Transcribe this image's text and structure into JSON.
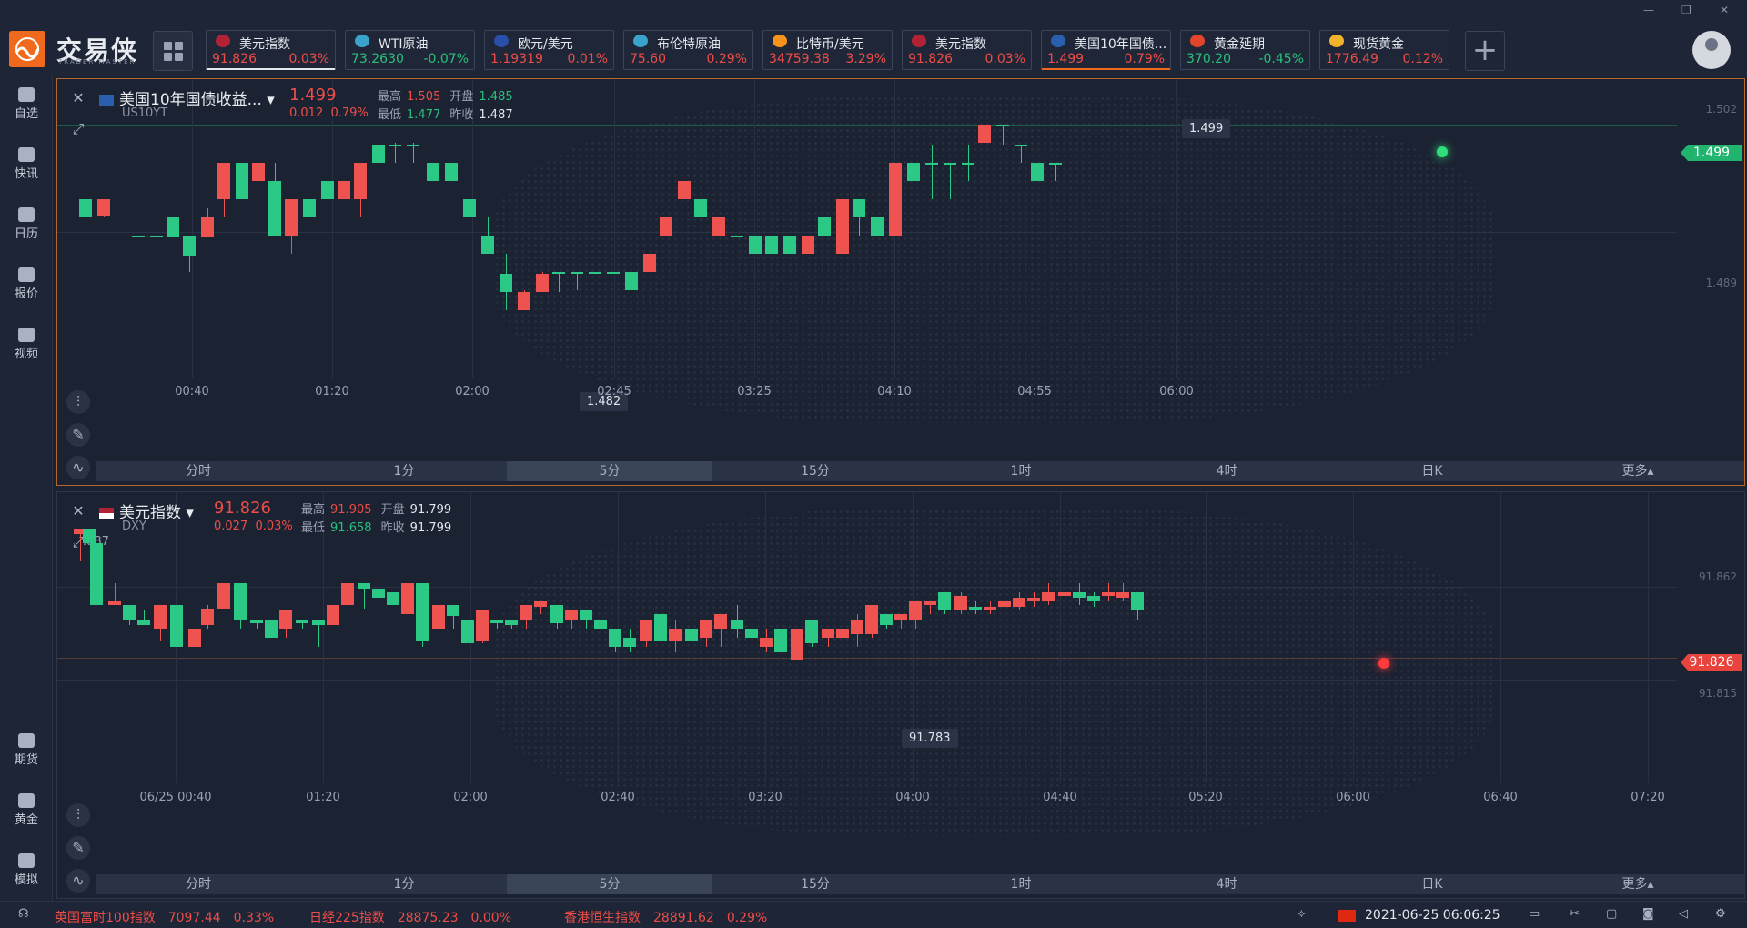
{
  "app": {
    "name": "交易侠",
    "subtitle": "TRADER MASTER"
  },
  "window_controls": [
    "—",
    "❐",
    "✕"
  ],
  "tabs": [
    {
      "name": "美元指数",
      "price": "91.826",
      "change": "0.03%",
      "dir": "up",
      "icon": "us-flag-icon"
    },
    {
      "name": "WTI原油",
      "price": "73.2630",
      "change": "-0.07%",
      "dir": "down",
      "icon": "oil-icon"
    },
    {
      "name": "欧元/美元",
      "price": "1.19319",
      "change": "0.01%",
      "dir": "up",
      "icon": "eu-us-flag-icon"
    },
    {
      "name": "布伦特原油",
      "price": "75.60",
      "change": "0.29%",
      "dir": "up",
      "icon": "oil-icon"
    },
    {
      "name": "比特币/美元",
      "price": "34759.38",
      "change": "3.29%",
      "dir": "up",
      "icon": "bitcoin-icon"
    },
    {
      "name": "美元指数",
      "price": "91.826",
      "change": "0.03%",
      "dir": "up",
      "icon": "us-flag-icon"
    },
    {
      "name": "美国10年国债...",
      "price": "1.499",
      "change": "0.79%",
      "dir": "up",
      "icon": "bond-icon"
    },
    {
      "name": "黄金延期",
      "price": "370.20",
      "change": "-0.45%",
      "dir": "down",
      "icon": "gold-icon"
    },
    {
      "name": "现货黄金",
      "price": "1776.49",
      "change": "0.12%",
      "dir": "up",
      "icon": "gold-coin-icon"
    }
  ],
  "sidebar": {
    "top": [
      {
        "label": "自选",
        "icon": "bookmark-icon"
      },
      {
        "label": "快讯",
        "icon": "news-icon"
      },
      {
        "label": "日历",
        "icon": "calendar-icon"
      },
      {
        "label": "报价",
        "icon": "trend-icon"
      },
      {
        "label": "视频",
        "icon": "video-icon"
      }
    ],
    "bottom": [
      {
        "label": "期货",
        "icon": "futures-icon"
      },
      {
        "label": "黄金",
        "icon": "gold-bar-icon"
      },
      {
        "label": "模拟",
        "icon": "wallet-icon"
      }
    ]
  },
  "labels": {
    "high": "最高",
    "low": "最低",
    "open": "开盘",
    "prev_close": "昨收"
  },
  "timeframes": [
    "分时",
    "1分",
    "5分",
    "15分",
    "1时",
    "4时",
    "日K",
    "更多▴"
  ],
  "watermark": {
    "cn": "交易侠",
    "en": "TRADER MASTER"
  },
  "chart1": {
    "title": "美国10年国债收益...",
    "code": "US10YT",
    "price": "1.499",
    "change": "0.012",
    "change_pct": "0.79%",
    "high": "1.505",
    "open": "1.485",
    "low": "1.477",
    "prev_close": "1.487",
    "y_labels": [
      "1.502",
      "1.489"
    ],
    "x_labels": [
      "00:40",
      "01:20",
      "02:00",
      "02:45",
      "03:25",
      "04:10",
      "04:55",
      "06:00"
    ],
    "last_tag": "1.499",
    "max_tip": "1.499",
    "min_tip": "1.482",
    "active_tf": 2
  },
  "chart2": {
    "title": "美元指数",
    "code": "DXY",
    "price": "91.826",
    "change": "0.027",
    "change_pct": "0.03%",
    "high": "91.905",
    "open": "91.799",
    "low": "91.658",
    "prev_close": "91.799",
    "y_labels": [
      "91.862",
      "91.815"
    ],
    "x_labels": [
      "06/25 00:40",
      "01:20",
      "02:00",
      "02:40",
      "03:20",
      "04:00",
      "04:40",
      "05:20",
      "06:00",
      "06:40",
      "07:20"
    ],
    "last_tag": "91.826",
    "max_tip": ".887",
    "min_tip": "91.783",
    "active_tf": 2
  },
  "footer": {
    "tickers": [
      {
        "name": "英国富时100指数",
        "value": "7097.44",
        "change": "0.33%"
      },
      {
        "name": "日经225指数",
        "value": "28875.23",
        "change": "0.00%"
      },
      {
        "name": "香港恒生指数",
        "value": "28891.62",
        "change": "0.29%"
      }
    ],
    "datetime": "2021-06-25 06:06:25"
  },
  "colors": {
    "up": "#ef5350",
    "down": "#2cc886",
    "accent": "#f06a1d",
    "bg": "#1b2232"
  }
}
